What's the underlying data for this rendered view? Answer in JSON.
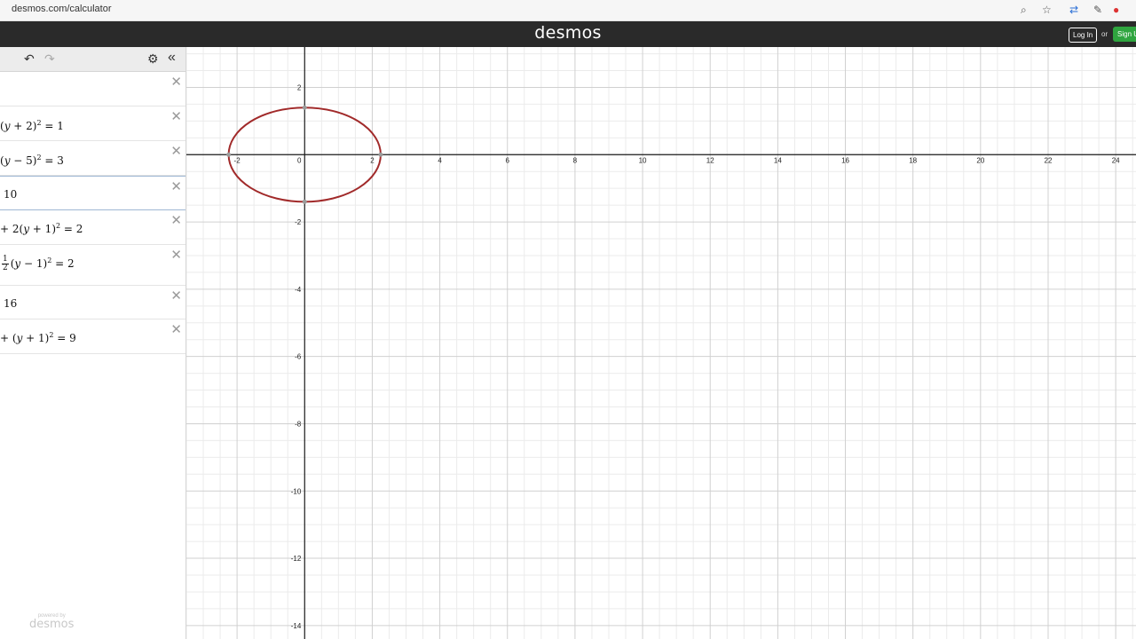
{
  "browser": {
    "url": "desmos.com/calculator",
    "icons": [
      "zoom-icon",
      "star-icon",
      "extension-icon",
      "eyedropper-icon",
      "color-wheel-icon"
    ]
  },
  "app": {
    "title": "desmos",
    "login_label": "Log In",
    "or_label": "or",
    "signup_label": "Sign Up"
  },
  "toolbar": {
    "undo_icon": "undo-icon",
    "redo_icon": "redo-icon",
    "settings_icon": "gear-icon",
    "collapse_icon": "collapse-double-chevron-icon"
  },
  "expressions": [
    {
      "kind": "empty"
    },
    {
      "prefix": "(",
      "var": "y",
      "op": " + ",
      "num": "2",
      "close": ")",
      "exp": "2",
      "rest": " = 1"
    },
    {
      "prefix": "(",
      "var": "y",
      "op": " − ",
      "num": "5",
      "close": ")",
      "exp": "2",
      "rest": " = 3"
    },
    {
      "kind": "plain",
      "text": "10"
    },
    {
      "lead": "+ 2",
      "prefix": "(",
      "var": "y",
      "op": " + ",
      "num": "1",
      "close": ")",
      "exp": "2",
      "rest": " = 2"
    },
    {
      "kind": "frac",
      "frac_n": "1",
      "frac_d": "2",
      "prefix": "(",
      "var": "y",
      "op": " − ",
      "num": "1",
      "close": ")",
      "exp": "2",
      "rest": " = 2"
    },
    {
      "kind": "plain",
      "text": "16"
    },
    {
      "lead": "+ ",
      "prefix": "(",
      "var": "y",
      "op": " + ",
      "num": "1",
      "close": ")",
      "exp": "2",
      "rest": " = 9"
    }
  ],
  "delete_icon": "close-icon",
  "powered_by": {
    "small": "powered by",
    "brand": "desmos"
  },
  "graph": {
    "x_ticks": [
      "-2",
      "0",
      "2",
      "4",
      "6",
      "8",
      "10",
      "12",
      "14",
      "16",
      "18",
      "20",
      "22",
      "24"
    ],
    "y_ticks_pos": [
      "2"
    ],
    "y_ticks_neg": [
      "-2",
      "-4",
      "-6",
      "-8",
      "-10",
      "-12",
      "-14"
    ],
    "x_range": [
      -3.5,
      24.6
    ],
    "y_range": [
      -14.4,
      3.2
    ],
    "ellipse": {
      "cx": 0,
      "cy": 0,
      "rx": 2.25,
      "ry": 1.4,
      "color": "#a12a2a"
    },
    "grid_minor": "#ebebeb",
    "grid_major": "#d0d0d0",
    "axis_color": "#1a1a1a"
  }
}
